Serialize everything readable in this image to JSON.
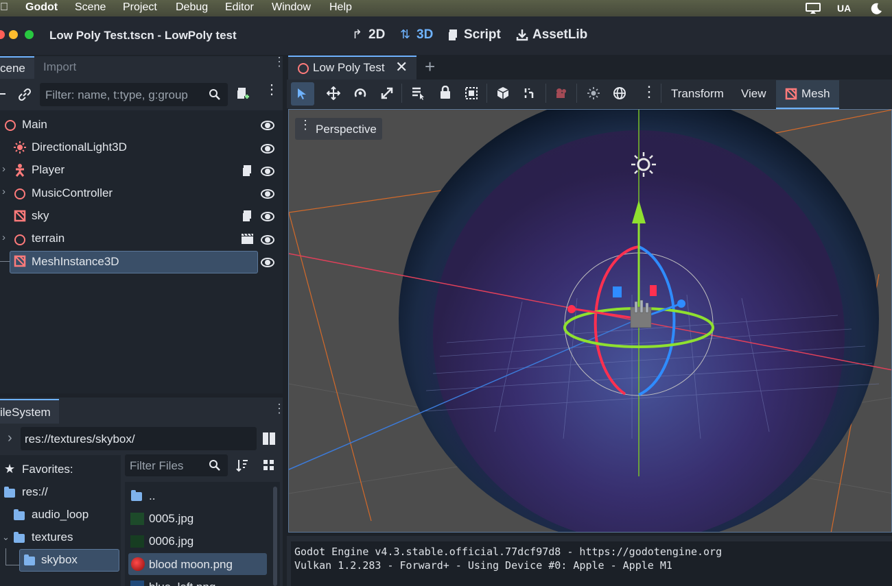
{
  "menubar": {
    "app": "Godot",
    "items": [
      "Scene",
      "Project",
      "Debug",
      "Editor",
      "Window",
      "Help"
    ],
    "input_source": "UA"
  },
  "window": {
    "title": "Low Poly Test.tscn - LowPoly test",
    "workspaces": [
      "2D",
      "3D",
      "Script",
      "AssetLib"
    ],
    "active_workspace": "3D"
  },
  "scene_dock": {
    "tabs": [
      "cene",
      "Import"
    ],
    "filter_placeholder": "Filter: name, t:type, g:group",
    "nodes": [
      {
        "name": "Main",
        "icon": "node3d-icon"
      },
      {
        "name": "DirectionalLight3D",
        "icon": "light-icon"
      },
      {
        "name": "Player",
        "icon": "character-icon",
        "has_script": true
      },
      {
        "name": "MusicController",
        "icon": "node3d-icon"
      },
      {
        "name": "sky",
        "icon": "mesh-icon",
        "has_script": true
      },
      {
        "name": "terrain",
        "icon": "node3d-icon",
        "instanced": true
      },
      {
        "name": "MeshInstance3D",
        "icon": "mesh-icon",
        "selected": true
      }
    ]
  },
  "filesystem_dock": {
    "tab": "ileSystem",
    "path": "res://textures/skybox/",
    "filter_placeholder": "Filter Files",
    "favorites_label": "Favorites:",
    "tree": [
      "res://",
      "audio_loop",
      "textures",
      "skybox"
    ],
    "files": [
      "..",
      "0005.jpg",
      "0006.jpg",
      "blood moon.png",
      "blue_left.png"
    ]
  },
  "editor": {
    "scene_tab": "Low Poly Test",
    "toolbar": {
      "transform": "Transform",
      "view": "View",
      "mesh": "Mesh"
    },
    "viewport_label": "Perspective"
  },
  "output": {
    "lines": [
      "Godot Engine v4.3.stable.official.77dcf97d8 - https://godotengine.org",
      "Vulkan 1.2.283 - Forward+ - Using Device #0: Apple - Apple M1"
    ]
  },
  "colors": {
    "accent": "#6fb3ff",
    "node_icon": "#ff7b7b",
    "selected_row": "#3a4f68"
  }
}
